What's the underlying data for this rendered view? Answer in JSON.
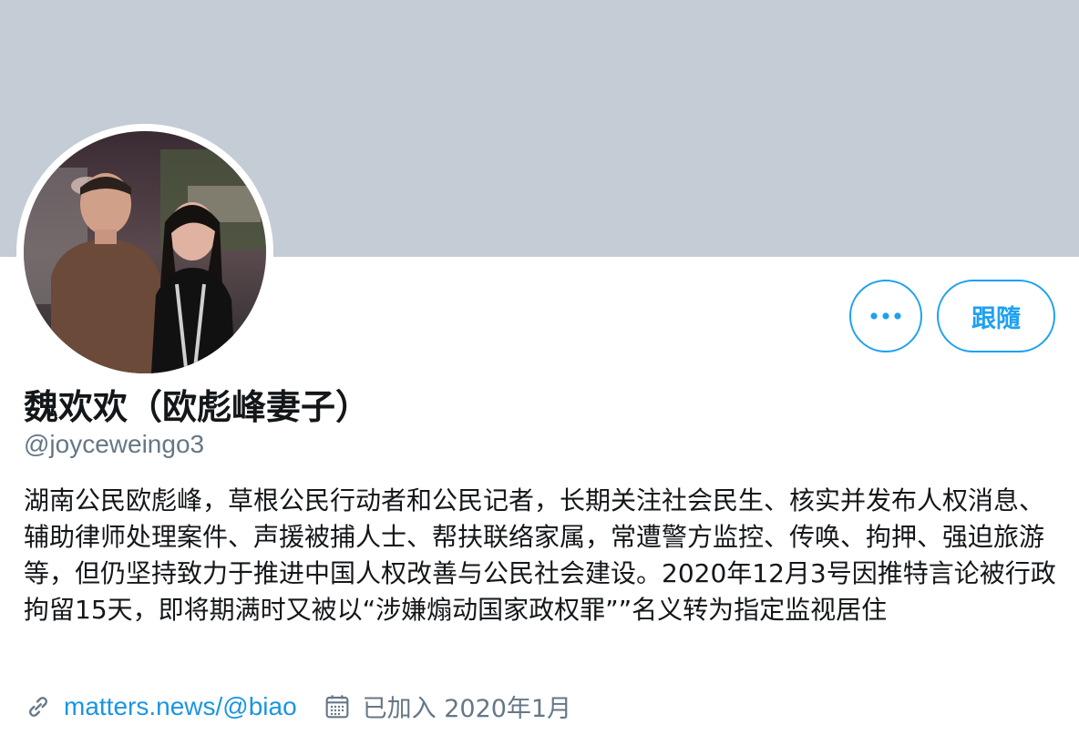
{
  "profile": {
    "display_name": "魏欢欢（欧彪峰妻子）",
    "handle": "@joyceweingo3",
    "bio": "湖南公民欧彪峰，草根公民行动者和公民记者，长期关注社会民生、核实并发布人权消息、辅助律师处理案件、声援被捕人士、帮扶联络家属，常遭警方监控、传唤、拘押、强迫旅游等，但仍坚持致力于推进中国人权改善与公民社会建设。2020年12月3号因推特言论被行政拘留15天，即将期满时又被以“涉嫌煽动国家政权罪””名义转为指定监视居住",
    "website": "matters.news/@biao",
    "joined": "已加入 2020年1月"
  },
  "actions": {
    "more_label": "•••",
    "follow_label": "跟隨"
  },
  "icons": {
    "link": "link-icon",
    "calendar": "calendar-icon",
    "more": "more-icon"
  },
  "colors": {
    "banner": "#c4cdd5",
    "accent": "#1da1f2",
    "link": "#1b95e0",
    "secondary_text": "#657786",
    "primary_text": "#14171a"
  }
}
